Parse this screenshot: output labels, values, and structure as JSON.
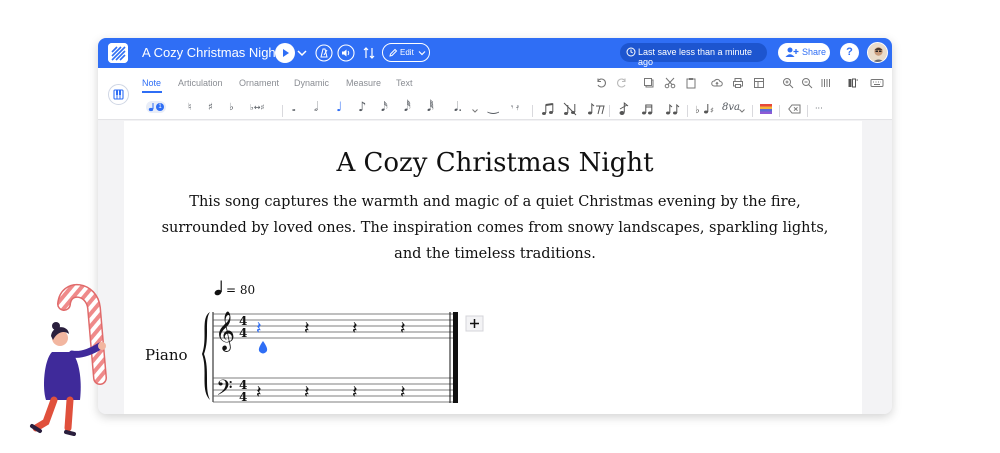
{
  "app": {
    "title": "A Cozy Christmas Night",
    "edit_label": "Edit",
    "save_status": "Last save less than a minute ago",
    "share_label": "Share",
    "help_label": "?"
  },
  "toolbar": {
    "tabs": [
      {
        "label": "Note",
        "active": true
      },
      {
        "label": "Articulation",
        "active": false
      },
      {
        "label": "Ornament",
        "active": false
      },
      {
        "label": "Dynamic",
        "active": false
      },
      {
        "label": "Measure",
        "active": false
      },
      {
        "label": "Text",
        "active": false
      }
    ],
    "voice_number": "1",
    "octave_label": "8va",
    "note_glyphs": {
      "natural": "♮",
      "sharp": "♯",
      "flat": "♭",
      "respell": "♭↔♯",
      "whole": "𝅝",
      "half": "𝅗𝅥",
      "quarter": "♩",
      "eighth": "♪",
      "sixteenth": "𝅘𝅥𝅯",
      "thirtysecond": "𝅘𝅥𝅰",
      "sixtyfourth": "𝅘𝅥𝅱",
      "dotted": "𝅘𝅥.",
      "tie": "‿",
      "rest_group": "𝄾 𝄿",
      "more": "···"
    }
  },
  "score": {
    "title": "A Cozy Christmas Night",
    "description": "This song captures the warmth and magic of a quiet Christmas evening by the fire, surrounded by loved ones. The inspiration comes from snowy landscapes, sparkling lights, and the timeless traditions.",
    "tempo_text": "= 80",
    "instrument": "Piano",
    "time_signature": "4/4",
    "add_measure_label": "+"
  },
  "colors": {
    "brand": "#2f6ef5",
    "selected_note": "#2f6ef5"
  }
}
